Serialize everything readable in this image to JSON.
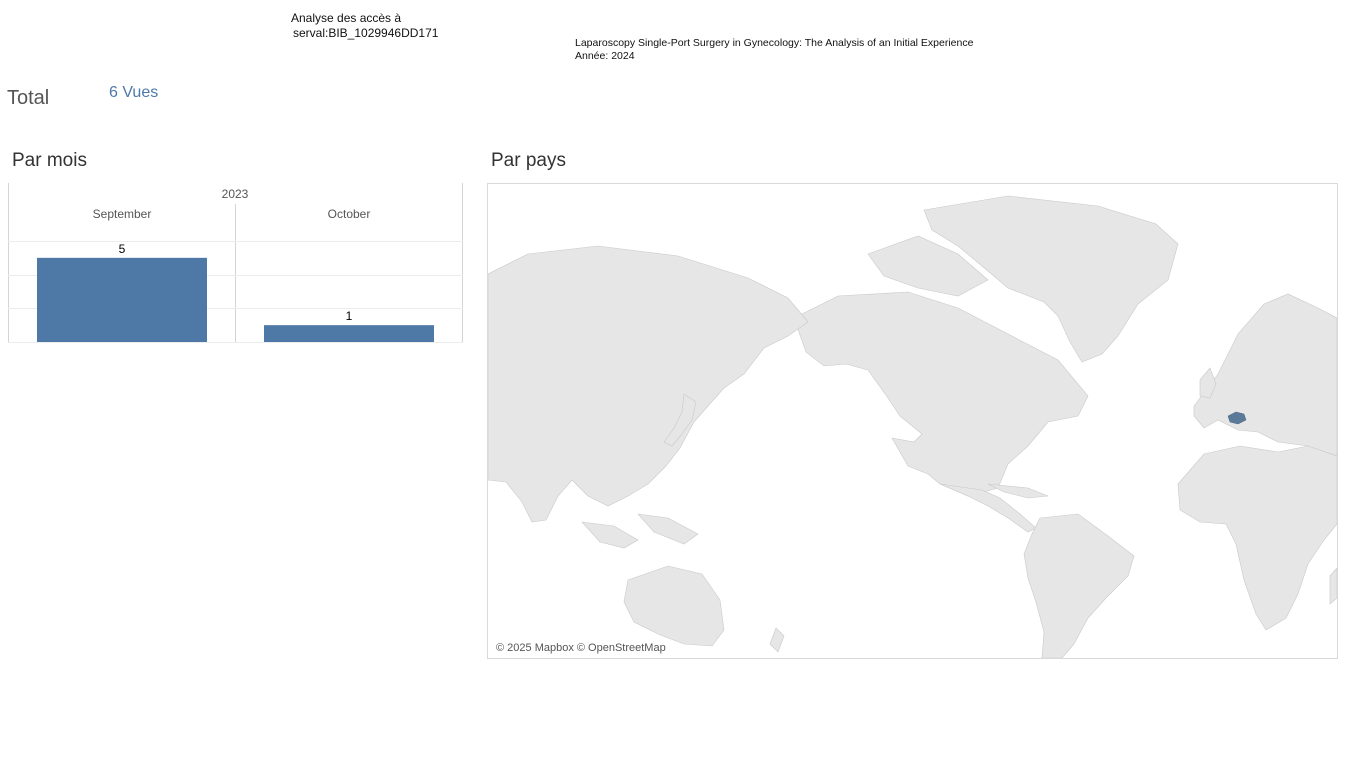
{
  "header": {
    "analysis_line1": "Analyse des accès à",
    "analysis_line2": "serval:BIB_1029946DD171",
    "publication_title": "Laparoscopy Single-Port Surgery in Gynecology: The Analysis of an Initial Experience",
    "publication_year": "Année: 2024"
  },
  "summary": {
    "total_label": "Total",
    "total_value": "6 Vues"
  },
  "sections": {
    "by_month": "Par mois",
    "by_country": "Par pays"
  },
  "chart_data": {
    "type": "bar",
    "year": "2023",
    "categories": [
      "September",
      "October"
    ],
    "values": [
      5,
      1
    ],
    "ylim": [
      0,
      6
    ],
    "bar_color": "#4e79a7",
    "grid": true
  },
  "map": {
    "attribution": "© 2025 Mapbox © OpenStreetMap",
    "land_color": "#e6e6e6",
    "highlight_color": "#5b7a99",
    "highlighted_country": "Switzerland"
  }
}
